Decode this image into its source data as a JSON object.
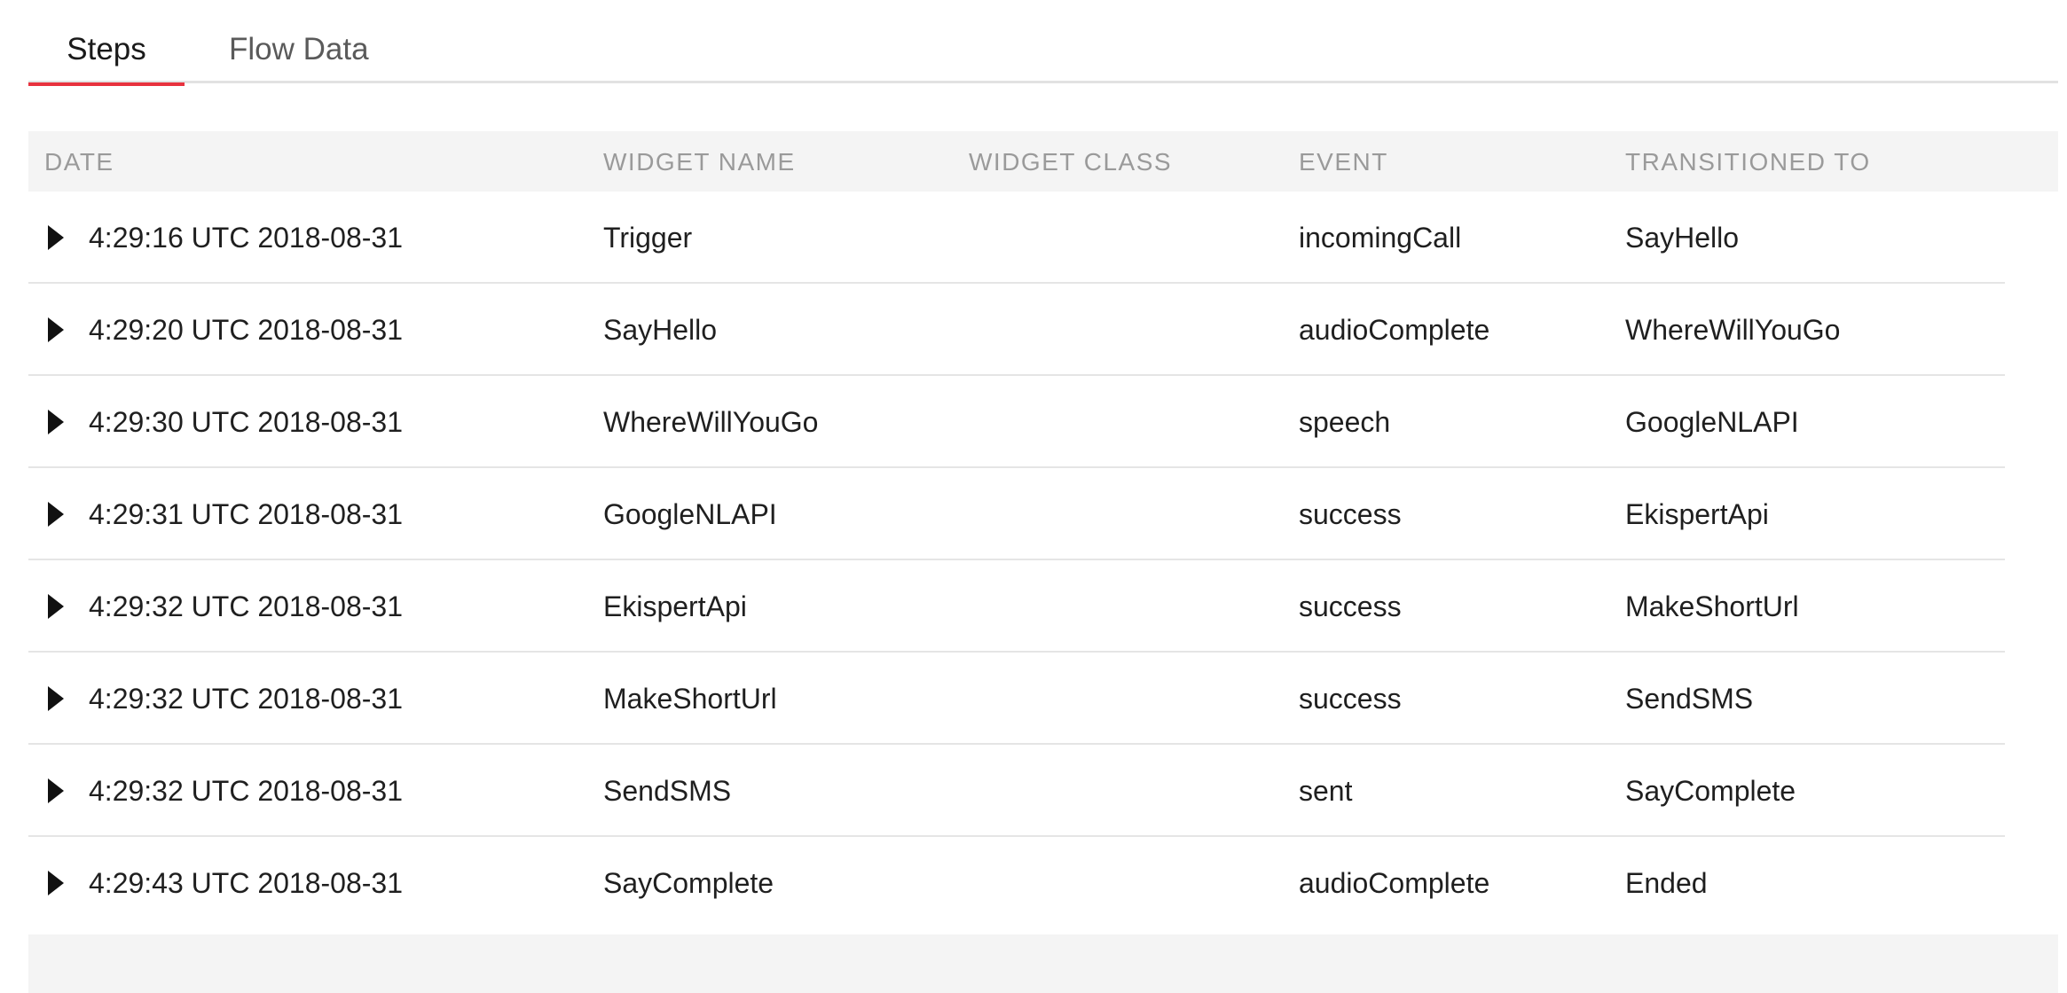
{
  "colors": {
    "accent": "#e8323e"
  },
  "tabs": [
    {
      "label": "Steps",
      "active": true
    },
    {
      "label": "Flow Data",
      "active": false
    }
  ],
  "table": {
    "columns": [
      "DATE",
      "WIDGET NAME",
      "WIDGET CLASS",
      "EVENT",
      "TRANSITIONED TO"
    ],
    "rows": [
      {
        "date": "4:29:16 UTC 2018-08-31",
        "widget_name": "Trigger",
        "widget_class": "",
        "event": "incomingCall",
        "transitioned_to": "SayHello"
      },
      {
        "date": "4:29:20 UTC 2018-08-31",
        "widget_name": "SayHello",
        "widget_class": "",
        "event": "audioComplete",
        "transitioned_to": "WhereWillYouGo"
      },
      {
        "date": "4:29:30 UTC 2018-08-31",
        "widget_name": "WhereWillYouGo",
        "widget_class": "",
        "event": "speech",
        "transitioned_to": "GoogleNLAPI"
      },
      {
        "date": "4:29:31 UTC 2018-08-31",
        "widget_name": "GoogleNLAPI",
        "widget_class": "",
        "event": "success",
        "transitioned_to": "EkispertApi"
      },
      {
        "date": "4:29:32 UTC 2018-08-31",
        "widget_name": "EkispertApi",
        "widget_class": "",
        "event": "success",
        "transitioned_to": "MakeShortUrl"
      },
      {
        "date": "4:29:32 UTC 2018-08-31",
        "widget_name": "MakeShortUrl",
        "widget_class": "",
        "event": "success",
        "transitioned_to": "SendSMS"
      },
      {
        "date": "4:29:32 UTC 2018-08-31",
        "widget_name": "SendSMS",
        "widget_class": "",
        "event": "sent",
        "transitioned_to": "SayComplete"
      },
      {
        "date": "4:29:43 UTC 2018-08-31",
        "widget_name": "SayComplete",
        "widget_class": "",
        "event": "audioComplete",
        "transitioned_to": "Ended"
      }
    ]
  }
}
